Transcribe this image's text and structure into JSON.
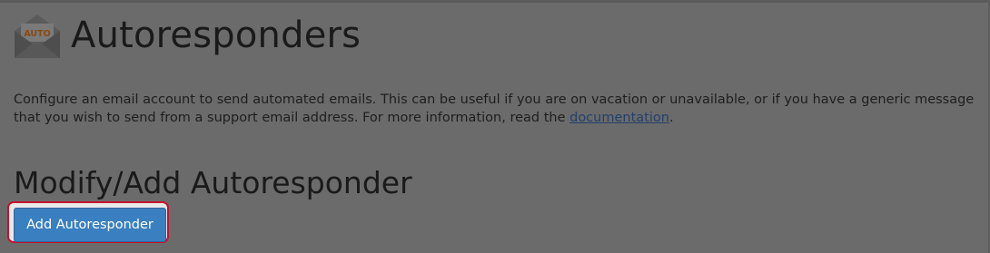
{
  "page": {
    "title": "Autoresponders",
    "icon": {
      "name": "autoresponder-envelope-icon",
      "badge_text": "AUTO"
    },
    "description_before": "Configure an email account to send automated emails. This can be useful if you are on vacation or unavailable, or if you have a generic message that you wish to send from a support email address. For more information, read the ",
    "description_link": "documentation",
    "description_after": "."
  },
  "section": {
    "title": "Modify/Add Autoresponder",
    "add_button_label": "Add Autoresponder"
  },
  "colors": {
    "overlay_background": "#6b6b6b",
    "button_blue": "#3a7fc0",
    "highlight_red": "#c8102e",
    "link": "#23406a"
  }
}
